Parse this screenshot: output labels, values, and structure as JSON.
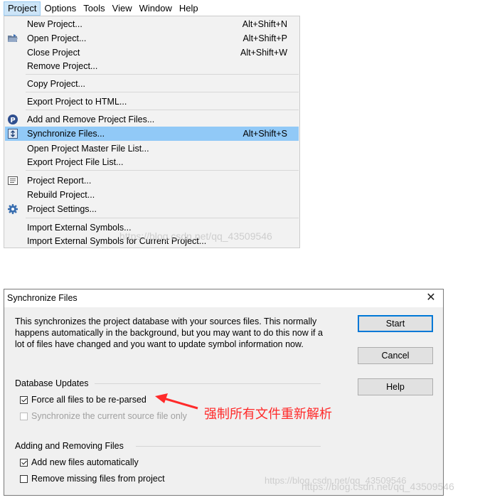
{
  "menubar": {
    "items": [
      "Project",
      "Options",
      "Tools",
      "View",
      "Window",
      "Help"
    ]
  },
  "menu": {
    "items": [
      {
        "label": "New Project...",
        "shortcut": "Alt+Shift+N",
        "icon": "none"
      },
      {
        "label": "Open Project...",
        "shortcut": "Alt+Shift+P",
        "icon": "open-folder-icon"
      },
      {
        "label": "Close Project",
        "shortcut": "Alt+Shift+W",
        "icon": "none"
      },
      {
        "label": "Remove Project...",
        "shortcut": "",
        "icon": "none"
      },
      {
        "label": "Copy Project...",
        "shortcut": "",
        "icon": "none"
      },
      {
        "label": "Export Project to HTML...",
        "shortcut": "",
        "icon": "none"
      },
      {
        "label": "Add and Remove Project Files...",
        "shortcut": "",
        "icon": "project-files-icon"
      },
      {
        "label": "Synchronize Files...",
        "shortcut": "Alt+Shift+S",
        "icon": "sync-icon",
        "highlighted": true
      },
      {
        "label": "Open Project Master File List...",
        "shortcut": "",
        "icon": "none"
      },
      {
        "label": "Export Project File List...",
        "shortcut": "",
        "icon": "none"
      },
      {
        "label": "Project Report...",
        "shortcut": "",
        "icon": "report-icon"
      },
      {
        "label": "Rebuild Project...",
        "shortcut": "",
        "icon": "none"
      },
      {
        "label": "Project Settings...",
        "shortcut": "",
        "icon": "gear-icon"
      },
      {
        "label": "Import External Symbols...",
        "shortcut": "",
        "icon": "none"
      },
      {
        "label": "Import External Symbols for Current Project...",
        "shortcut": "",
        "icon": "none"
      }
    ],
    "highlight_color": "#91c9f7"
  },
  "watermark_menu": "https://blog.csdn.net/qq_43509546",
  "dialog": {
    "title": "Synchronize Files",
    "description": "This synchronizes the project database with your sources files. This normally happens automatically in the background, but you may want to do this now if a lot of files have changed and you want to update symbol information now.",
    "buttons": {
      "start": "Start",
      "cancel": "Cancel",
      "help": "Help"
    },
    "group_db": "Database Updates",
    "cb_force": "Force all files to be re-parsed",
    "cb_sync": "Synchronize the current source file only",
    "group_files": "Adding and Removing Files",
    "cb_add": "Add new files automatically",
    "cb_remove": "Remove missing files from project"
  },
  "annotation": "强制所有文件重新解析",
  "annotation_color": "#ff2a2a",
  "watermark_dialog_1": "https://blog.csdn.net/qq_43509546",
  "watermark_dialog_2": "https://blog.csdn.net/qq_43509546"
}
